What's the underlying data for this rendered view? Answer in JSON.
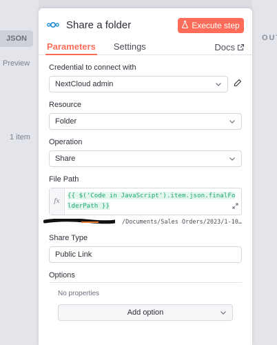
{
  "background": {
    "json_tab": "JSON",
    "preview": "Preview",
    "item_count": "1 item",
    "output_label": "OUT"
  },
  "header": {
    "title": "Share a folder",
    "execute_label": "Execute step",
    "accent_color": "#ff6d5a"
  },
  "tabs": [
    {
      "label": "Parameters",
      "active": true
    },
    {
      "label": "Settings",
      "active": false
    }
  ],
  "docs_label": "Docs",
  "fields": {
    "credential": {
      "label": "Credential to connect with",
      "value": "NextCloud admin"
    },
    "resource": {
      "label": "Resource",
      "value": "Folder"
    },
    "operation": {
      "label": "Operation",
      "value": "Share"
    },
    "file_path": {
      "label": "File Path",
      "expression": "{{ $('Code in JavaScript').item.json.finalFolderPath }}",
      "resolved": "/Documents/Sales Orders/2023/1-10…"
    },
    "share_type": {
      "label": "Share Type",
      "value": "Public Link"
    }
  },
  "options": {
    "title": "Options",
    "empty_text": "No properties",
    "add_label": "Add option"
  }
}
